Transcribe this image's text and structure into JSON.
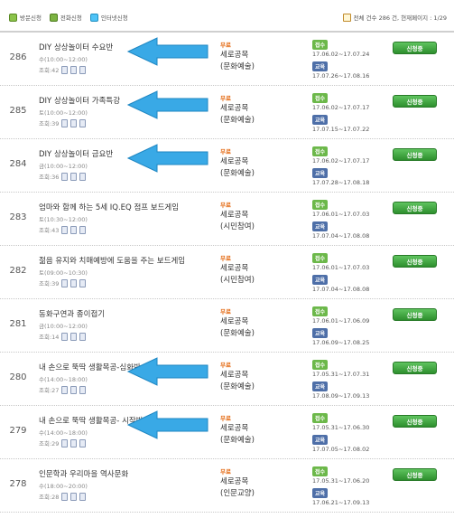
{
  "legend": [
    "방문신청",
    "전화신청",
    "인터넷신청"
  ],
  "summary": "전체 건수 286 건, 현재페이지 : 1/29",
  "rows": [
    {
      "num": "286",
      "title": "DIY 상상놀이터 수요반",
      "time": "수(10:00~12:00)",
      "views": "조회:42",
      "fee": "무료",
      "place": "세로공목",
      "category": "(문화예술)",
      "apply": "17.06.02~17.07.24",
      "edu": "17.07.26~17.08.16",
      "button": "신청중",
      "arrow": true
    },
    {
      "num": "285",
      "title": "DIY 상상놀이터 가족특강",
      "time": "토(10:00~12:00)",
      "views": "조회:39",
      "fee": "무료",
      "place": "세로공목",
      "category": "(문화예술)",
      "apply": "17.06.02~17.07.17",
      "edu": "17.07.15~17.07.22",
      "button": "신청중",
      "arrow": true
    },
    {
      "num": "284",
      "title": "DIY 상상놀이터 금요반",
      "time": "금(10:00~12:00)",
      "views": "조회:36",
      "fee": "무료",
      "place": "세로공목",
      "category": "(문화예술)",
      "apply": "17.06.02~17.07.17",
      "edu": "17.07.28~17.08.18",
      "button": "신청중",
      "arrow": true
    },
    {
      "num": "283",
      "title": "엄마와 함께 하는 5세 IQ.EQ 점프 보드게임",
      "time": "토(10:30~12:00)",
      "views": "조회:43",
      "fee": "무료",
      "place": "세로공목",
      "category": "(시민참여)",
      "apply": "17.06.01~17.07.03",
      "edu": "17.07.04~17.08.08",
      "button": "신청중",
      "arrow": false
    },
    {
      "num": "282",
      "title": "젊음 유지와 치매예방에 도움을 주는 보드게임",
      "time": "토(09:00~10:30)",
      "views": "조회:39",
      "fee": "무료",
      "place": "세로공목",
      "category": "(시민참여)",
      "apply": "17.06.01~17.07.03",
      "edu": "17.07.04~17.08.08",
      "button": "신청중",
      "arrow": false
    },
    {
      "num": "281",
      "title": "동화구연과 종이접기",
      "time": "금(10:00~12:00)",
      "views": "조회:14",
      "fee": "무료",
      "place": "세로공목",
      "category": "(문화예술)",
      "apply": "17.06.01~17.06.09",
      "edu": "17.06.09~17.08.25",
      "button": "신청중",
      "arrow": false
    },
    {
      "num": "280",
      "title": "내 손으로 뚝딱 생활목공-심화반",
      "time": "수(14:00~18:00)",
      "views": "조회:27",
      "fee": "무료",
      "place": "세로공목",
      "category": "(문화예술)",
      "apply": "17.05.31~17.07.31",
      "edu": "17.08.09~17.09.13",
      "button": "신청중",
      "arrow": true
    },
    {
      "num": "279",
      "title": "내 손으로 뚝딱 생활목공- 시작반",
      "time": "수(14:00~18:00)",
      "views": "조회:29",
      "fee": "무료",
      "place": "세로공목",
      "category": "(문화예술)",
      "apply": "17.05.31~17.06.30",
      "edu": "17.07.05~17.08.02",
      "button": "신청중",
      "arrow": true
    },
    {
      "num": "278",
      "title": "인문학과 우리마을 역사문화",
      "time": "수(18:00~20:00)",
      "views": "조회:28",
      "fee": "무료",
      "place": "세로공목",
      "category": "(인문교양)",
      "apply": "17.05.31~17.06.20",
      "edu": "17.06.21~17.09.13",
      "button": "신청중",
      "arrow": false
    }
  ],
  "badges": {
    "apply": "접수",
    "edu": "교육"
  },
  "colors": {
    "fee": "#e46b15",
    "arrow": "#39a9e6",
    "button": "#3aa33a"
  }
}
